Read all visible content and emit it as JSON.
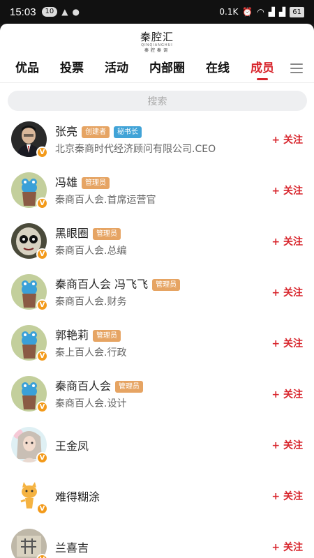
{
  "status": {
    "time": "15:03",
    "badge": "10",
    "network": "0.1K",
    "battery": "61"
  },
  "logo": {
    "main": "秦腔汇",
    "sub": "QINQIANGHUI",
    "sub2": "秦腔秦调"
  },
  "tabs": [
    {
      "label": "优品"
    },
    {
      "label": "投票"
    },
    {
      "label": "活动"
    },
    {
      "label": "内部圈"
    },
    {
      "label": "在线"
    },
    {
      "label": "成员",
      "active": true
    }
  ],
  "search": {
    "placeholder": "搜索"
  },
  "follow_label": "+ 关注",
  "members": [
    {
      "name": "张亮",
      "badges": [
        {
          "text": "创建者",
          "color": "orange"
        },
        {
          "text": "秘书长",
          "color": "blue"
        }
      ],
      "subtitle": "北京秦商时代经济顾问有限公司.CEO",
      "avatar": "photo-suit"
    },
    {
      "name": "冯雄",
      "badges": [
        {
          "text": "管理员",
          "color": "orange"
        }
      ],
      "subtitle": "秦商百人会.首席运营官",
      "avatar": "cartoon"
    },
    {
      "name": "黑眼圈",
      "badges": [
        {
          "text": "管理员",
          "color": "orange"
        }
      ],
      "subtitle": "秦商百人会.总编",
      "avatar": "doll"
    },
    {
      "name": "秦商百人会 冯飞飞",
      "badges": [
        {
          "text": "管理员",
          "color": "orange"
        }
      ],
      "subtitle": "秦商百人会.财务",
      "avatar": "cartoon"
    },
    {
      "name": "郭艳莉",
      "badges": [
        {
          "text": "管理员",
          "color": "orange"
        }
      ],
      "subtitle": "秦上百人会.行政",
      "avatar": "cartoon"
    },
    {
      "name": "秦商百人会",
      "badges": [
        {
          "text": "管理员",
          "color": "orange"
        }
      ],
      "subtitle": "秦商百人会.设计",
      "avatar": "cartoon"
    },
    {
      "name": "王金凤",
      "badges": [],
      "subtitle": "",
      "avatar": "girl"
    },
    {
      "name": "难得糊涂",
      "badges": [],
      "subtitle": "",
      "avatar": "cat"
    },
    {
      "name": "兰喜吉",
      "badges": [],
      "subtitle": "",
      "avatar": "stamp"
    }
  ],
  "colors": {
    "accent": "#d8262d",
    "badge_orange": "#e6a463",
    "badge_blue": "#41a3d7",
    "vip": "#f39a1a"
  }
}
